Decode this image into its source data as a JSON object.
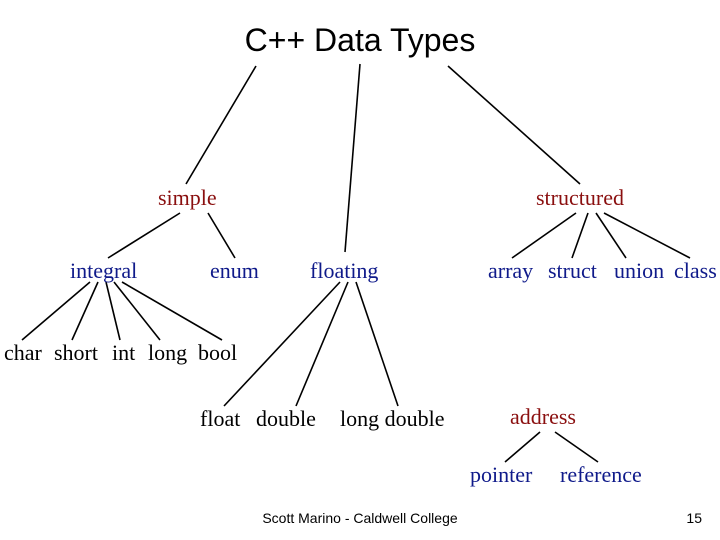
{
  "title": "C++ Data Types",
  "level1": {
    "simple": "simple",
    "structured": "structured"
  },
  "simple_children": {
    "integral": "integral",
    "enum": "enum",
    "floating": "floating"
  },
  "integral_children": [
    "char",
    "short",
    "int",
    "long",
    "bool"
  ],
  "floating_children": [
    "float",
    "double",
    "long double"
  ],
  "structured_children": [
    "array",
    "struct",
    "union",
    "class"
  ],
  "address": {
    "label": "address",
    "children": [
      "pointer",
      "reference"
    ]
  },
  "footer": "Scott Marino - Caldwell College",
  "page_number": "15"
}
